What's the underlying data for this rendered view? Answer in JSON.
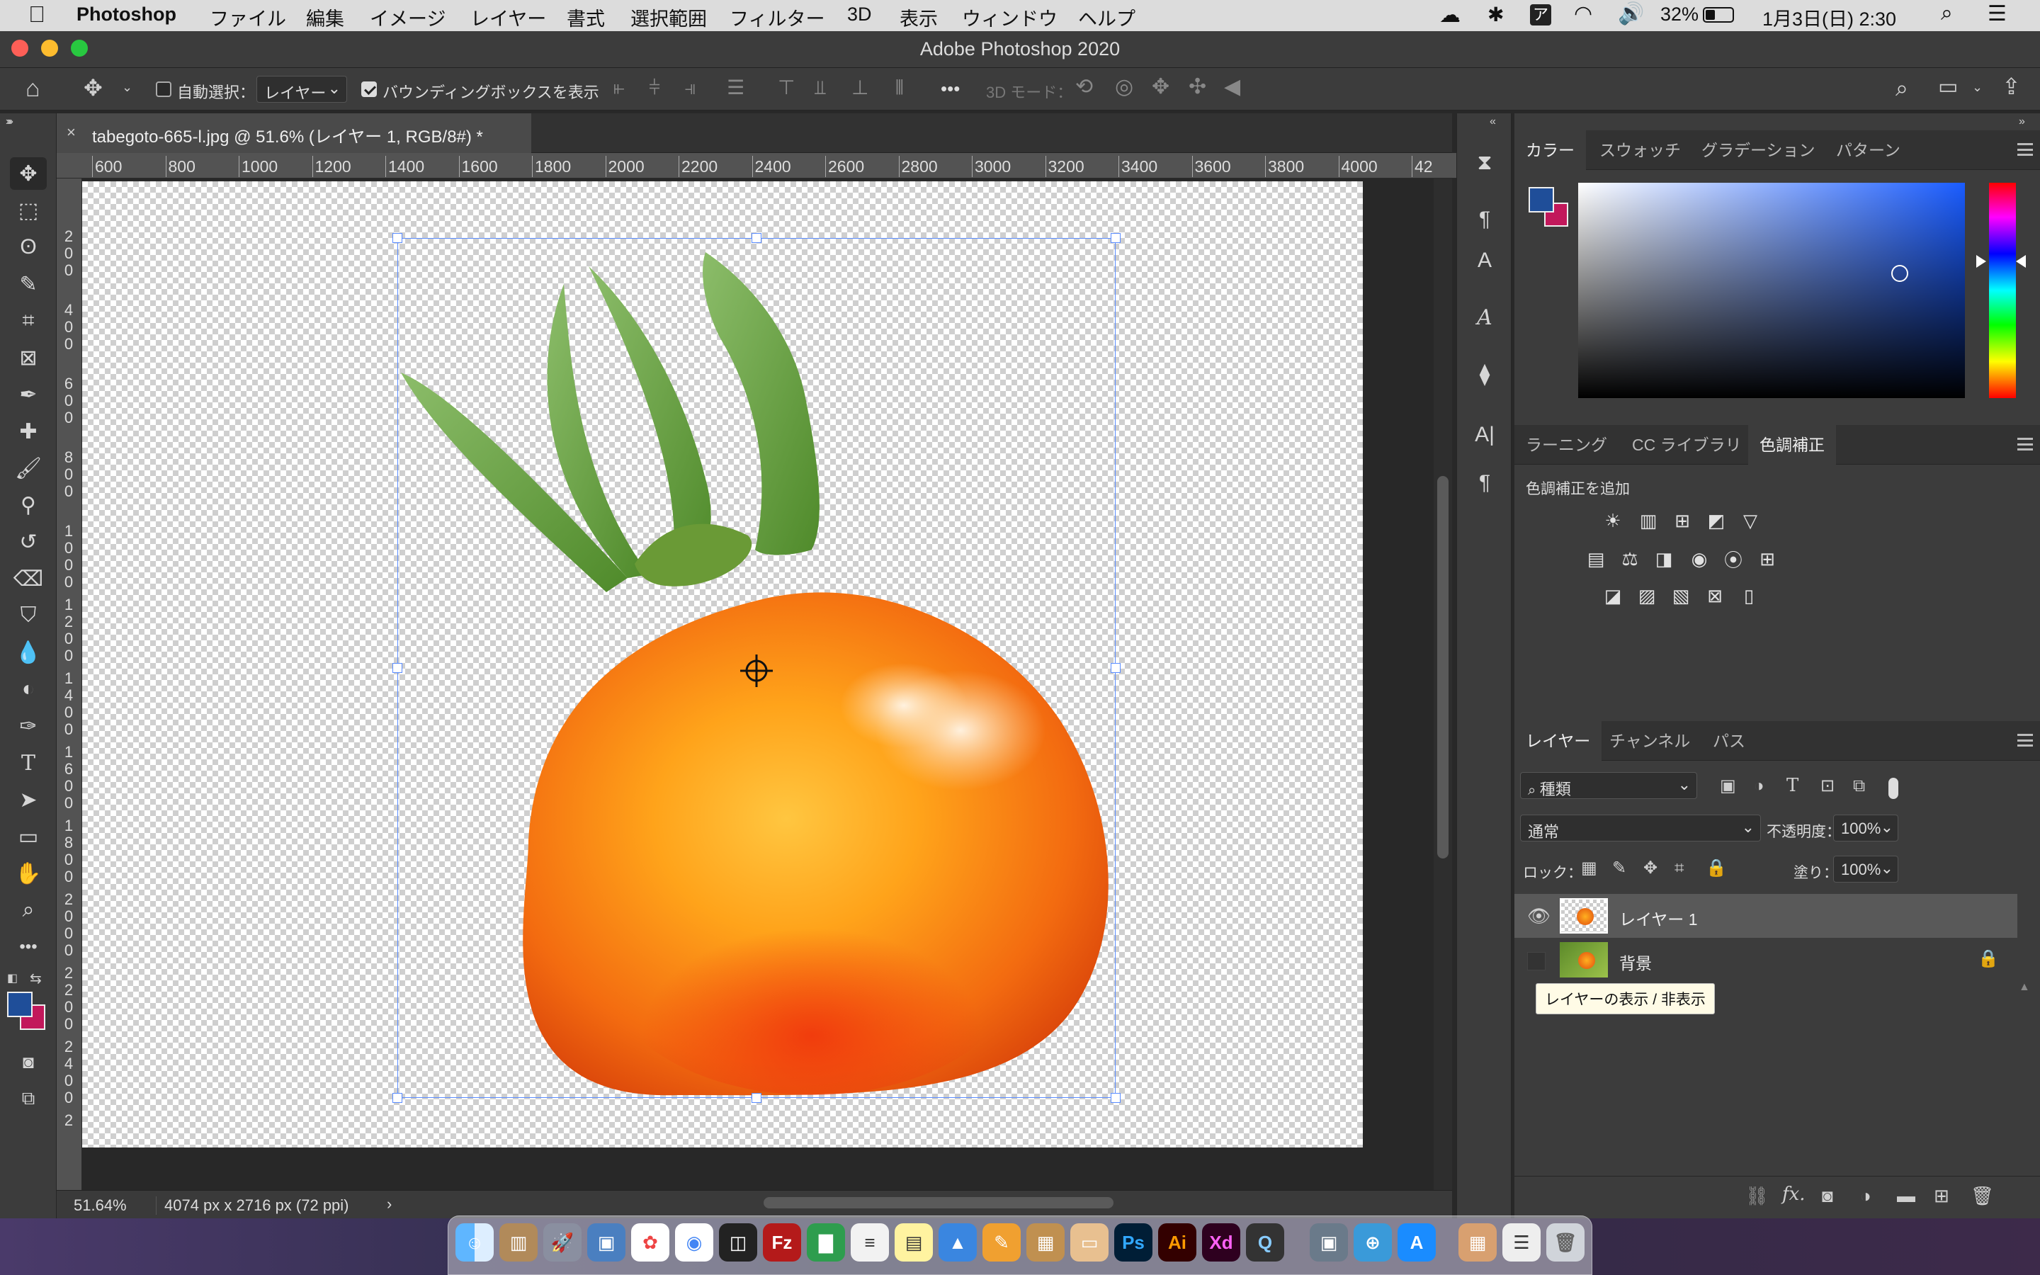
{
  "menubar": {
    "apple": "",
    "app_name": "Photoshop",
    "items": [
      "ファイル",
      "編集",
      "イメージ",
      "レイヤー",
      "書式",
      "選択範囲",
      "フィルター",
      "3D",
      "表示",
      "ウィンドウ",
      "ヘルプ"
    ],
    "battery": "32%",
    "datetime": "1月3日(日) 2:30"
  },
  "window": {
    "title": "Adobe Photoshop 2020"
  },
  "options": {
    "auto_select_label": "自動選択：",
    "auto_select_target": "レイヤー",
    "bounding_box_label": "バウンディングボックスを表示",
    "more": "•••",
    "mode_3d_label": "3D モード："
  },
  "document": {
    "tab_title": "tabegoto-665-l.jpg @ 51.6% (レイヤー 1, RGB/8#) *",
    "close": "×",
    "zoom": "51.64%",
    "dimensions": "4074 px x 2716 px (72 ppi)",
    "ruler_h": [
      "600",
      "800",
      "1000",
      "1200",
      "1400",
      "1600",
      "1800",
      "2000",
      "2200",
      "2400",
      "2600",
      "2800",
      "3000",
      "3200",
      "3400",
      "3600",
      "3800",
      "4000",
      "42"
    ],
    "ruler_v": [
      "2",
      "0",
      "0",
      "4",
      "0",
      "0",
      "6",
      "0",
      "0",
      "8",
      "0",
      "0",
      "1",
      "0",
      "0",
      "0",
      "1",
      "2",
      "0",
      "0",
      "1",
      "4",
      "0",
      "0",
      "1",
      "6",
      "0",
      "0",
      "1",
      "8",
      "0",
      "0",
      "2",
      "0",
      "0",
      "0",
      "2",
      "2",
      "0",
      "0",
      "2",
      "4",
      "0",
      "0",
      "2",
      "6",
      "0",
      "0",
      "2"
    ]
  },
  "color_panel": {
    "tabs": [
      "カラー",
      "スウォッチ",
      "グラデーション",
      "パターン"
    ],
    "foreground": "#1f4e99",
    "background": "#c2185b"
  },
  "adjustments_panel": {
    "tabs": [
      "ラーニング",
      "CC ライブラリ",
      "色調補正"
    ],
    "add_label": "色調補正を追加"
  },
  "layers_panel": {
    "tabs": [
      "レイヤー",
      "チャンネル",
      "パス"
    ],
    "filter_kind": "種類",
    "blend_mode": "通常",
    "opacity_label": "不透明度：",
    "opacity": "100%",
    "lock_label": "ロック：",
    "fill_label": "塗り：",
    "fill": "100%",
    "layers": [
      {
        "name": "レイヤー 1",
        "visible": true,
        "selected": true
      },
      {
        "name": "背景",
        "visible": false,
        "locked": true
      }
    ],
    "tooltip": "レイヤーの表示 / 非表示",
    "footer_fx": "fx."
  },
  "dock": {
    "apps": [
      "Finder",
      "Notes",
      "Launchpad",
      "Preview",
      "Photos",
      "Chrome",
      "Codepen",
      "FileZilla",
      "Numbers",
      "TextEdit",
      "Stickies",
      "Keynote",
      "Pages",
      "Archive",
      "Folder",
      "Ps",
      "Ai",
      "Xd",
      "QuickTime",
      "Image Capture",
      "Network",
      "App Store",
      "Photos Library",
      "Lists",
      "Trash"
    ]
  }
}
